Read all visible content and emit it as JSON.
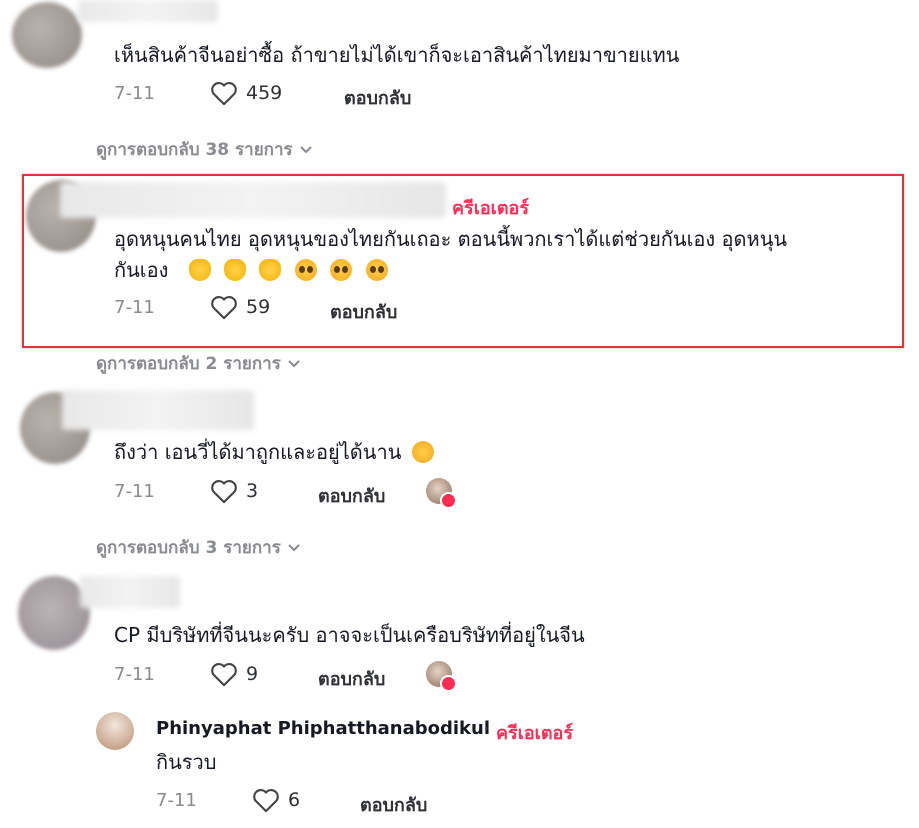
{
  "comments": [
    {
      "text": "เห็นสินค้าจีนอย่าซื้อ ถ้าขายไม่ได้เขาก็จะเอาสินค้าไทยมาขายแทน",
      "date": "7-11",
      "likes": "459",
      "reply_label": "ตอบกลับ",
      "view_replies": "ดูการตอบกลับ 38 รายการ"
    },
    {
      "creator_badge": "ครีเอเตอร์",
      "text_line1": "อุดหนุนคนไทย อุดหนุนของไทยกันเถอะ ตอนนี้พวกเราได้แต่ช่วยกันเอง อุดหนุน",
      "text_line2": "กันเอง",
      "date": "7-11",
      "likes": "59",
      "reply_label": "ตอบกลับ",
      "view_replies": "ดูการตอบกลับ 2 รายการ"
    },
    {
      "text": "ถึงว่า เอนวี่ได้มาถูกและอยู่ได้นาน",
      "date": "7-11",
      "likes": "3",
      "reply_label": "ตอบกลับ",
      "view_replies": "ดูการตอบกลับ 3 รายการ"
    },
    {
      "text": "CP มีบริษัทที่จีนนะครับ อาจจะเป็นเครือบริษัทที่อยู่ในจีน",
      "date": "7-11",
      "likes": "9",
      "reply_label": "ตอบกลับ"
    }
  ],
  "creator_reply": {
    "name": "Phinyaphat Phiphatthanabodikul",
    "separator": "·",
    "creator_badge": "ครีเอเตอร์",
    "text": "กินรวบ",
    "date": "7-11",
    "likes": "6",
    "reply_label": "ตอบกลับ"
  },
  "icons": {
    "like": "heart-outline-icon",
    "expand": "chevron-down-icon"
  },
  "colors": {
    "creator": "#fe2c55",
    "highlight_border": "#d9383a",
    "muted": "#8a8b91"
  }
}
